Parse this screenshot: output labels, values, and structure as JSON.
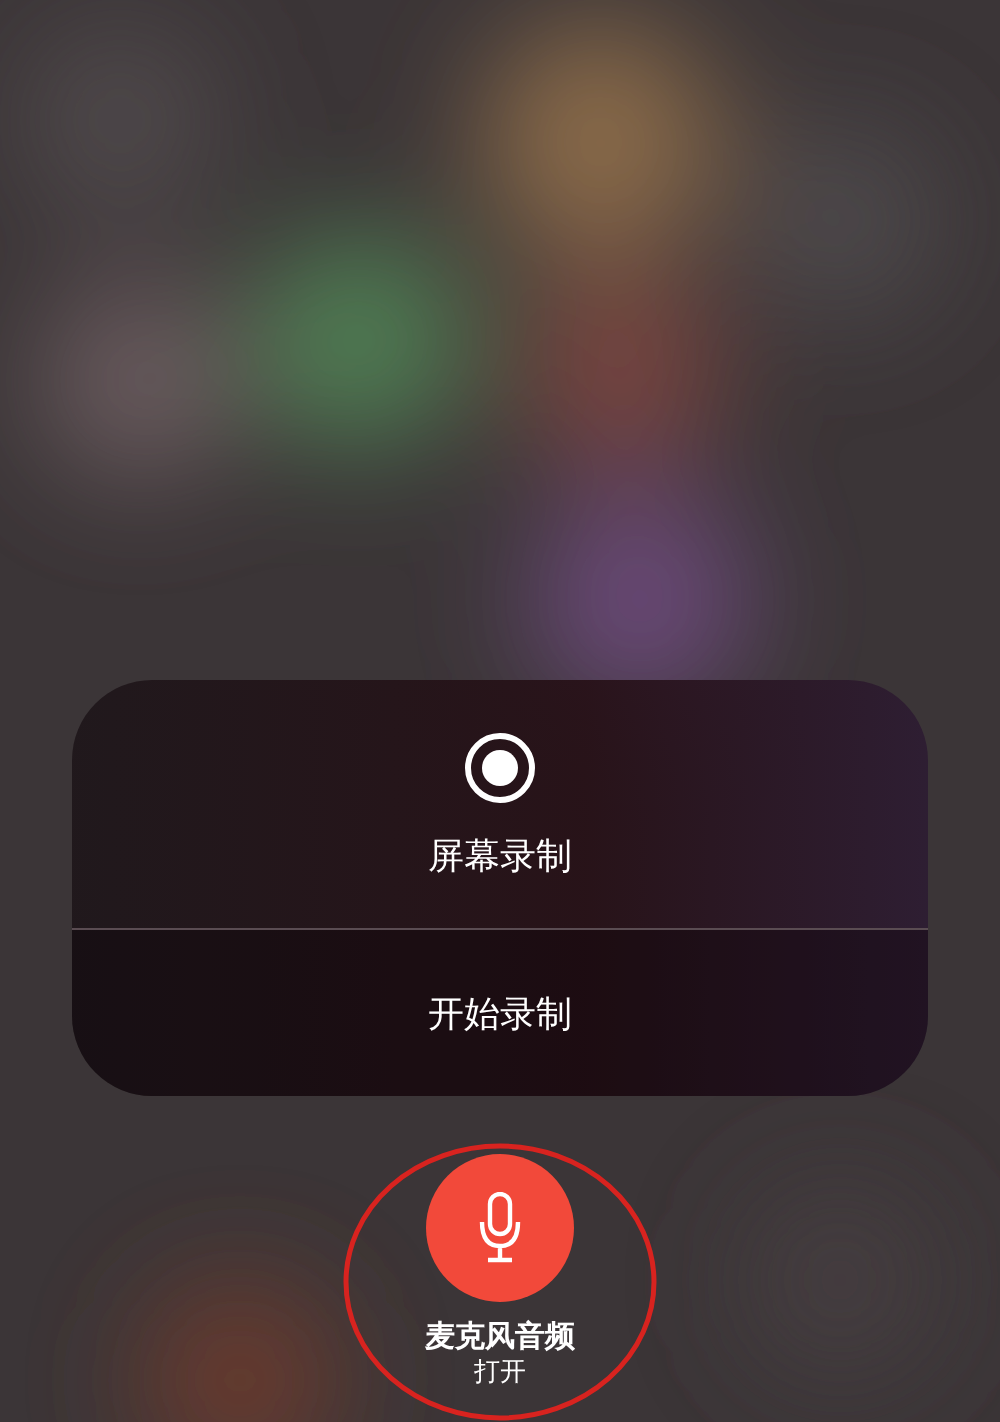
{
  "panel": {
    "title": "屏幕录制",
    "action": "开始录制"
  },
  "microphone": {
    "label": "麦克风音频",
    "status": "打开",
    "on": true
  }
}
